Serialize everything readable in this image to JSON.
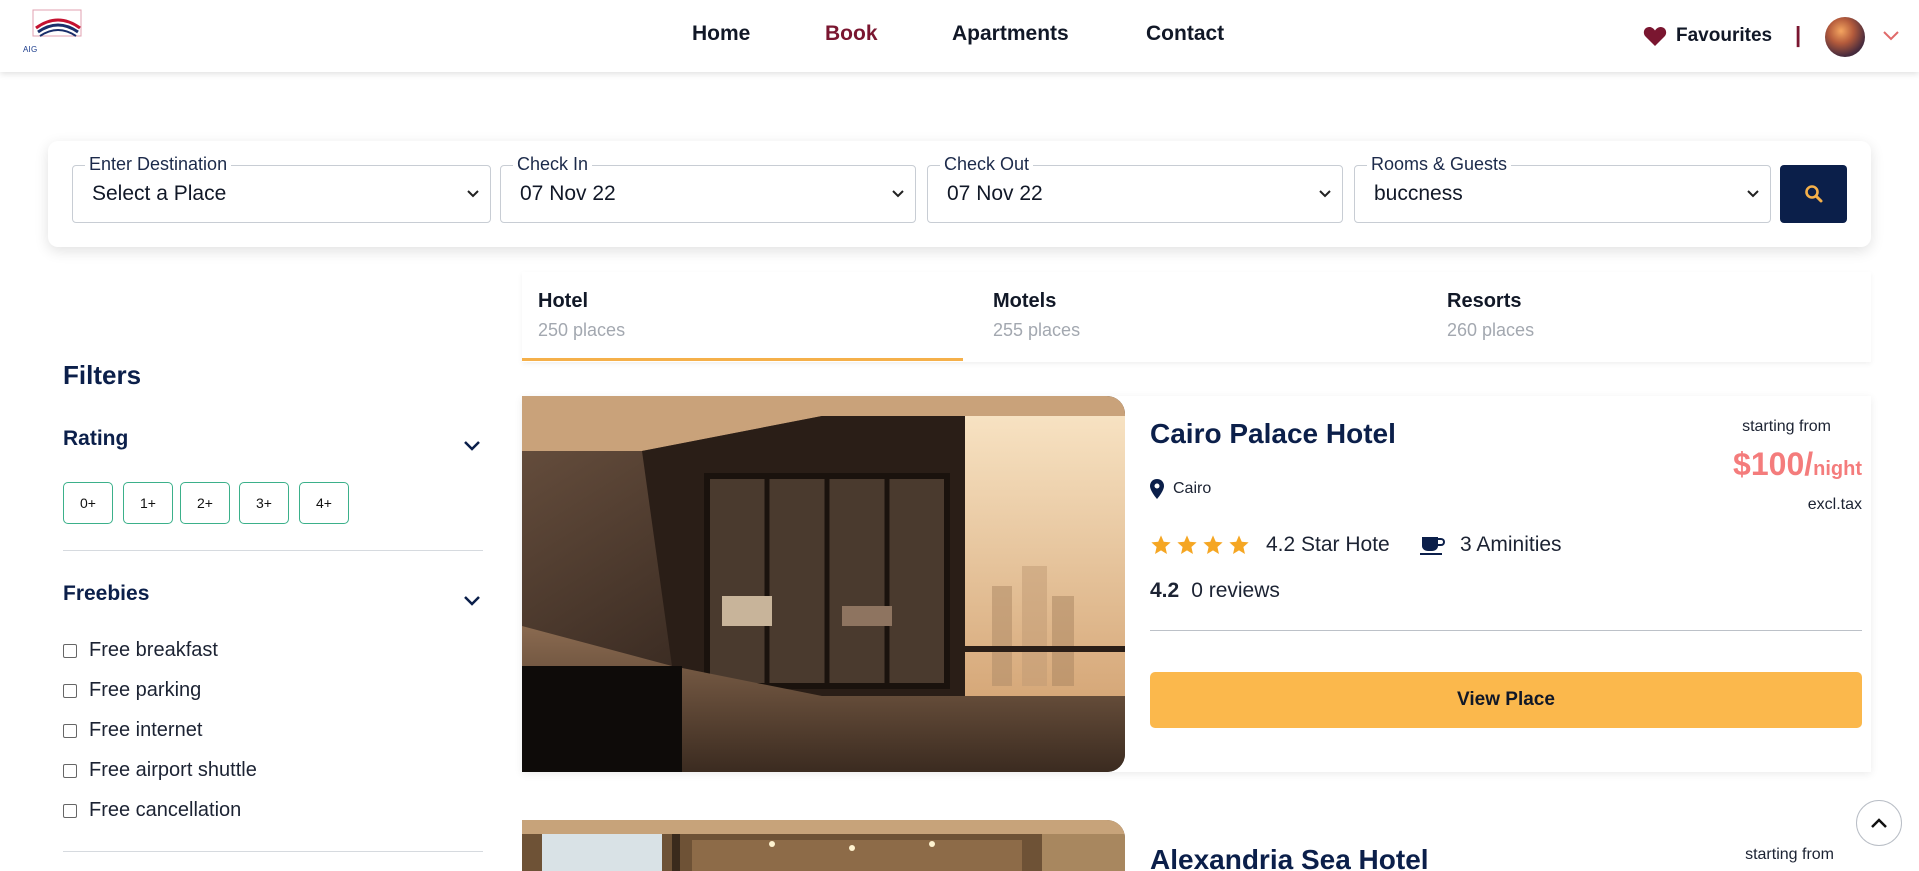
{
  "header": {
    "logo_text": "AIG",
    "nav": [
      {
        "label": "Home",
        "active": false
      },
      {
        "label": "Book",
        "active": true
      },
      {
        "label": "Apartments",
        "active": false
      },
      {
        "label": "Contact",
        "active": false
      }
    ],
    "favourites_label": "Favourites",
    "separator": "|"
  },
  "search": {
    "destination": {
      "legend": "Enter Destination",
      "value": "Select a Place"
    },
    "check_in": {
      "legend": "Check In",
      "value": "07 Nov 22"
    },
    "check_out": {
      "legend": "Check Out",
      "value": "07 Nov 22"
    },
    "rooms_guests": {
      "legend": "Rooms & Guests",
      "value": "buccness"
    }
  },
  "filters": {
    "title": "Filters",
    "rating": {
      "title": "Rating",
      "chips": [
        "0+",
        "1+",
        "2+",
        "3+",
        "4+"
      ]
    },
    "freebies": {
      "title": "Freebies",
      "items": [
        "Free breakfast",
        "Free parking",
        "Free internet",
        "Free airport shuttle",
        "Free cancellation"
      ]
    }
  },
  "tabs": [
    {
      "label": "Hotel",
      "sub": "250 places",
      "active": true
    },
    {
      "label": "Motels",
      "sub": "255 places",
      "active": false
    },
    {
      "label": "Resorts",
      "sub": "260 places",
      "active": false
    }
  ],
  "listings": [
    {
      "name": "Cairo Palace Hotel",
      "location": "Cairo",
      "starting_from": "starting from",
      "price": "$100/",
      "price_unit": "night",
      "tax": "excl.tax",
      "stars": 4,
      "star_text": "4.2 Star Hote",
      "amenities": "3 Aminities",
      "rating": "4.2",
      "reviews": "0 reviews",
      "button": "View Place"
    },
    {
      "name": "Alexandria Sea Hotel",
      "starting_from": "starting from"
    }
  ],
  "colors": {
    "primary_navy": "#0b1f4a",
    "accent_orange": "#fbb84c",
    "price_red": "#f47c7c",
    "active_maroon": "#7a1630",
    "chip_green": "#3bb08a"
  }
}
